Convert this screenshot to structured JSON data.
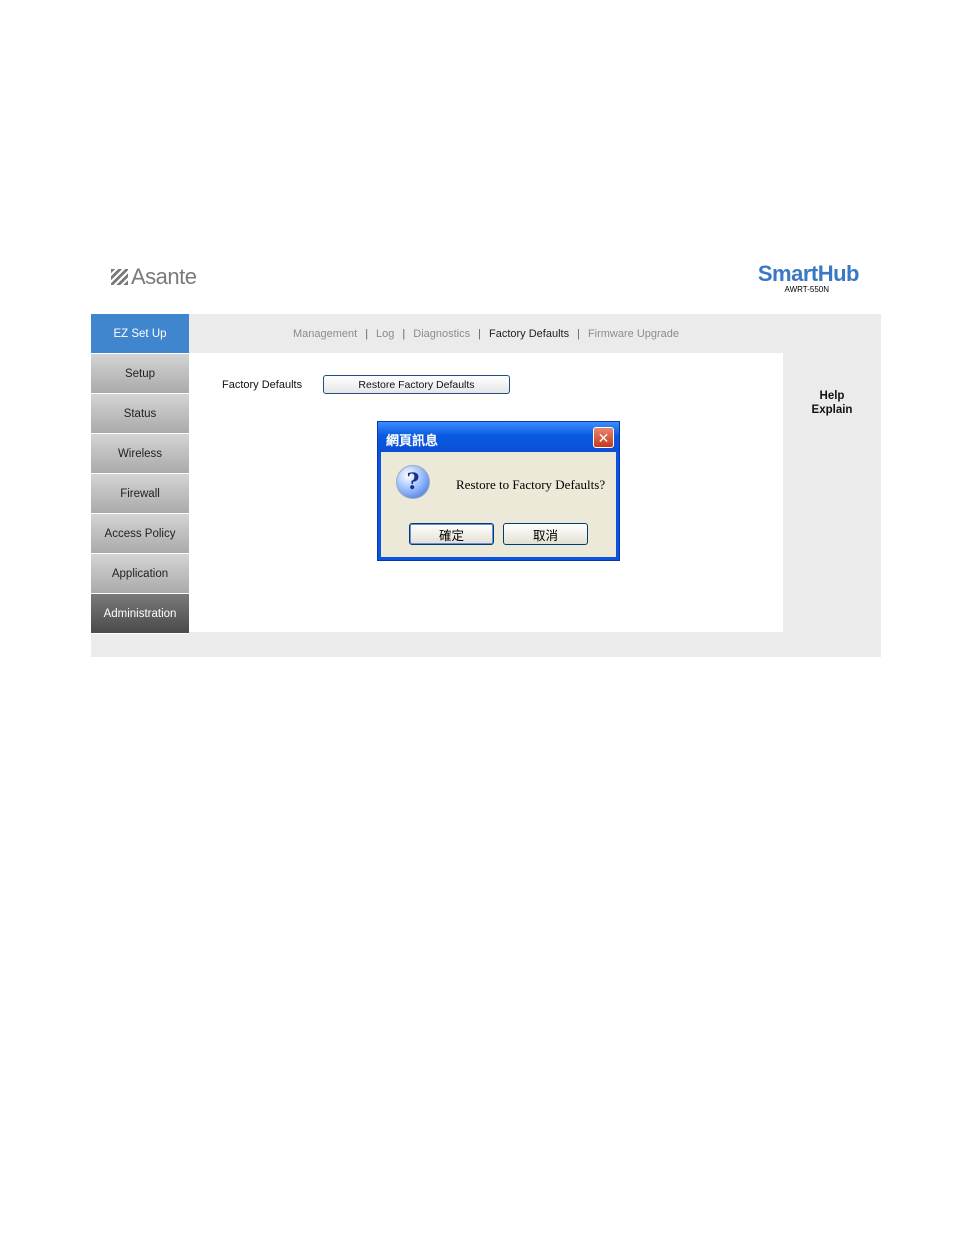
{
  "header": {
    "brand": "Asante",
    "product": "SmartHub",
    "model": "AWRT-550N"
  },
  "sidebar": {
    "items": [
      {
        "label": "EZ Set Up"
      },
      {
        "label": "Setup"
      },
      {
        "label": "Status"
      },
      {
        "label": "Wireless"
      },
      {
        "label": "Firewall"
      },
      {
        "label": "Access Policy"
      },
      {
        "label": "Application"
      },
      {
        "label": "Administration"
      }
    ]
  },
  "subnav": {
    "links": [
      "Management",
      "Log",
      "Diagnostics",
      "Factory Defaults",
      "Firmware Upgrade"
    ],
    "separator": "|",
    "current": "Factory Defaults"
  },
  "content": {
    "label": "Factory Defaults",
    "button": "Restore Factory Defaults"
  },
  "help": {
    "line1": "Help",
    "line2": "Explain"
  },
  "dialog": {
    "title": "網頁訊息",
    "message": "Restore to Factory Defaults?",
    "ok": "確定",
    "cancel": "取消",
    "close_symbol": "✕",
    "icon_symbol": "?"
  },
  "colors": {
    "accent": "#3f86cf",
    "brand_blue": "#3a78c6",
    "dialog_blue": "#0b54e0",
    "close_red": "#c5381d"
  },
  "icons": {
    "brand_mark": "asante-logo-icon",
    "dialog_question": "question-icon",
    "dialog_close": "close-icon"
  }
}
